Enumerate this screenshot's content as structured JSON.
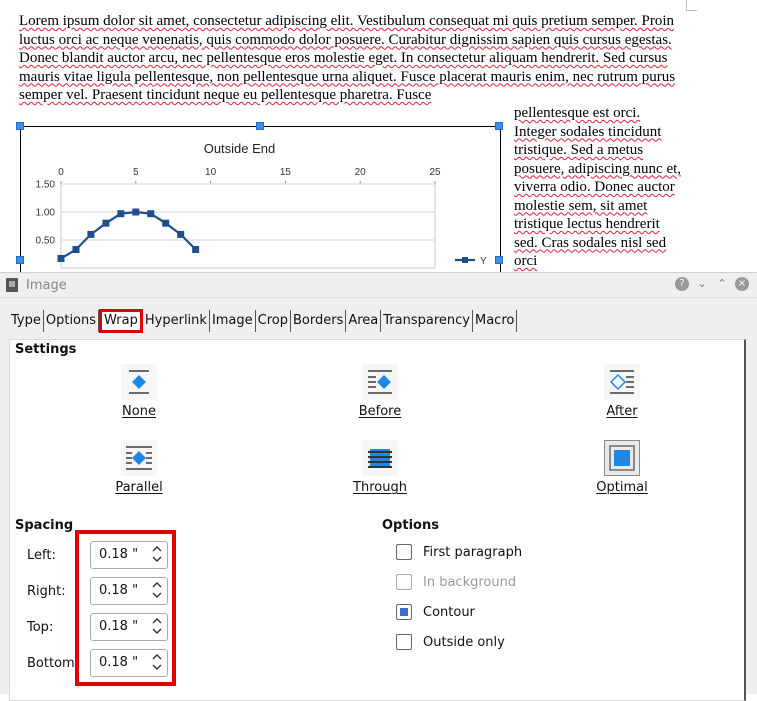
{
  "document": {
    "paragraph_top": "Lorem ipsum dolor sit amet, consectetur adipiscing elit. Vestibulum consequat mi quis pretium semper. Proin luctus orci ac neque venenatis, quis commodo dolor posuere. Curabitur dignissim sapien quis cursus egestas. Donec blandit auctor arcu, nec pellentesque eros molestie eget. In consectetur aliquam hendrerit. Sed cursus mauris vitae ligula pellentesque, non pellentesque urna aliquet. Fusce placerat mauris enim, nec rutrum purus semper vel. Praesent tincidunt neque eu pellentesque pharetra. Fusce",
    "paragraph_side": "pellentesque est orci. Integer sodales tincidunt tristique. Sed a metus posuere, adipiscing nunc et, viverra odio. Donec auctor molestie sem, sit amet tristique lectus hendrerit sed. Cras sodales nisl sed orci"
  },
  "chart_data": {
    "type": "line",
    "title": "Outside End",
    "x_ticks": [
      "0",
      "5",
      "10",
      "15",
      "20",
      "25"
    ],
    "y_ticks": [
      "1.50",
      "1.00",
      "0.50"
    ],
    "xlim": [
      0,
      25
    ],
    "ylim": [
      0,
      1.5
    ],
    "series": [
      {
        "name": "Y",
        "color": "#1f4e8c",
        "x": [
          0,
          1,
          2,
          3,
          4,
          5,
          6,
          7,
          8,
          9
        ],
        "y": [
          0.17,
          0.33,
          0.6,
          0.8,
          0.97,
          1.0,
          0.97,
          0.8,
          0.6,
          0.33
        ]
      }
    ]
  },
  "dialog": {
    "title": "Image",
    "controls": {
      "help": "?",
      "collapse": "⌄",
      "expand": "⌃",
      "close": "×"
    },
    "tabs": [
      "Type",
      "Options",
      "Wrap",
      "Hyperlink",
      "Image",
      "Crop",
      "Borders",
      "Area",
      "Transparency",
      "Macro"
    ],
    "active_tab": "Wrap",
    "settings": {
      "title": "Settings",
      "options": [
        {
          "label": "None",
          "icon": "wrap-none-icon"
        },
        {
          "label": "Before",
          "icon": "wrap-before-icon"
        },
        {
          "label": "After",
          "icon": "wrap-after-icon"
        },
        {
          "label": "Parallel",
          "icon": "wrap-parallel-icon"
        },
        {
          "label": "Through",
          "icon": "wrap-through-icon"
        },
        {
          "label": "Optimal",
          "icon": "wrap-optimal-icon"
        }
      ],
      "selected": "Optimal"
    },
    "spacing": {
      "title": "Spacing",
      "fields": [
        {
          "label": "Left:",
          "value": "0.18 \""
        },
        {
          "label": "Right:",
          "value": "0.18 \""
        },
        {
          "label": "Top:",
          "value": "0.18 \""
        },
        {
          "label": "Bottom",
          "value": "0.18 \""
        }
      ]
    },
    "options": {
      "title": "Options",
      "items": [
        {
          "label": "First paragraph",
          "checked": false,
          "enabled": true
        },
        {
          "label": "In background",
          "checked": false,
          "enabled": false
        },
        {
          "label": "Contour",
          "checked": true,
          "enabled": true
        },
        {
          "label": "Outside only",
          "checked": false,
          "enabled": true
        }
      ]
    }
  },
  "colors": {
    "accent_blue": "#3c8ee8",
    "highlight_red": "#e00000",
    "series_blue": "#1f4e8c"
  }
}
